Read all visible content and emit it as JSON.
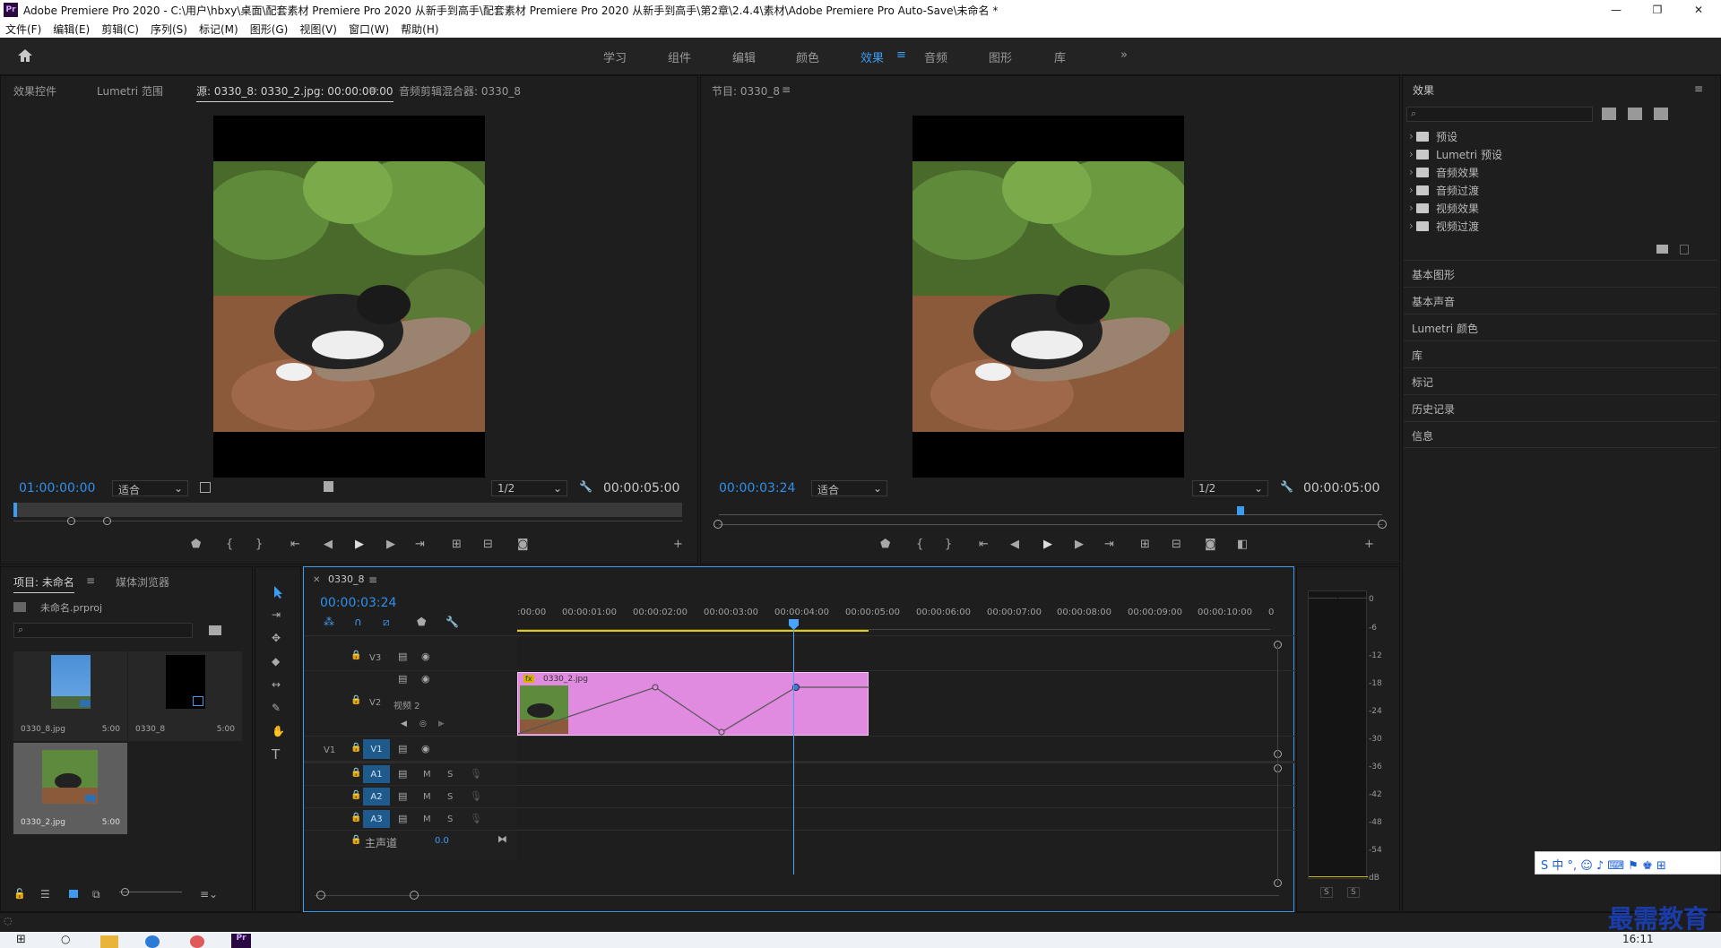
{
  "window": {
    "app_badge": "Pr",
    "title": "Adobe Premiere Pro 2020 - C:\\用户\\hbxy\\桌面\\配套素材 Premiere Pro 2020 从新手到高手\\配套素材 Premiere Pro 2020 从新手到高手\\第2章\\2.4.4\\素材\\Adobe Premiere Pro Auto-Save\\未命名 *"
  },
  "menu": [
    "文件(F)",
    "编辑(E)",
    "剪辑(C)",
    "序列(S)",
    "标记(M)",
    "图形(G)",
    "视图(V)",
    "窗口(W)",
    "帮助(H)"
  ],
  "workspaces": {
    "tabs": [
      "学习",
      "组件",
      "编辑",
      "颜色",
      "效果",
      "音频",
      "图形",
      "库"
    ],
    "active": "效果",
    "more": "»"
  },
  "source_monitor": {
    "tabs": [
      "效果控件",
      "Lumetri 范围",
      "源: 0330_8: 0330_2.jpg: 00:00:00:00",
      "音频剪辑混合器: 0330_8"
    ],
    "timecode": "01:00:00:00",
    "fit": "适合",
    "resolution": "1/2",
    "duration": "00:00:05:00"
  },
  "program_monitor": {
    "title": "节目: 0330_8",
    "timecode": "00:00:03:24",
    "fit": "适合",
    "resolution": "1/2",
    "duration": "00:00:05:00"
  },
  "effects_panel": {
    "title": "效果",
    "items": [
      "预设",
      "Lumetri 预设",
      "音频效果",
      "音频过渡",
      "视频效果",
      "视频过渡"
    ],
    "sections": [
      "基本图形",
      "基本声音",
      "Lumetri 颜色",
      "库",
      "标记",
      "历史记录",
      "信息"
    ]
  },
  "project_panel": {
    "tabs": [
      "项目: 未命名",
      "媒体浏览器"
    ],
    "file": "未命名.prproj",
    "items": [
      {
        "name": "0330_8.jpg",
        "duration": "5:00"
      },
      {
        "name": "0330_8",
        "duration": "5:00"
      },
      {
        "name": "0330_2.jpg",
        "duration": "5:00"
      }
    ]
  },
  "timeline": {
    "sequence": "0330_8",
    "timecode": "00:00:03:24",
    "ruler": [
      ":00:00",
      "00:00:01:00",
      "00:00:02:00",
      "00:00:03:00",
      "00:00:04:00",
      "00:00:05:00",
      "00:00:06:00",
      "00:00:07:00",
      "00:00:08:00",
      "00:00:09:00",
      "00:00:10:00",
      "0"
    ],
    "tracks": {
      "v3": "V3",
      "v2": "V2",
      "v2_name": "视频 2",
      "v1": "V1",
      "a1": "A1",
      "a2": "A2",
      "a3": "A3",
      "m": "M",
      "s": "S",
      "master": "主声道",
      "master_value": "0.0"
    },
    "clip": {
      "name": "0330_2.jpg",
      "fx": "fx"
    }
  },
  "meter": {
    "ticks": [
      "0",
      "-6",
      "-12",
      "-18",
      "-24",
      "-30",
      "-36",
      "-42",
      "-48",
      "-54",
      "dB"
    ],
    "solo": [
      "S",
      "S"
    ]
  },
  "ime_bar": "S 中 °, ☺ ♪ ⌨ ⚑ ♚ ⊞",
  "watermark": "最需教育",
  "taskbar_time": "16:11",
  "colors": {
    "accent_blue": "#2f8fe9",
    "clip_pink": "#e08ae0",
    "playhead": "#4aa3ff"
  }
}
